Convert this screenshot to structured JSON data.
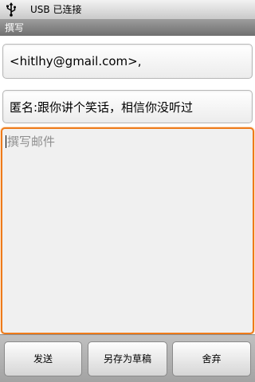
{
  "status_bar": {
    "icon": "usb-icon",
    "text": "USB 已连接"
  },
  "title_bar": {
    "title": "撰写"
  },
  "compose": {
    "to_value": "<hitlhy@gmail.com>,",
    "subject_value": "匿名:跟你讲个笑话，相信你没听过",
    "body_placeholder": "撰写邮件"
  },
  "buttons": {
    "send": "发送",
    "save_draft": "另存为草稿",
    "discard": "舍弃"
  },
  "colors": {
    "focus_border": "#ee7a1a",
    "title_bar": "#8a8a8a"
  }
}
